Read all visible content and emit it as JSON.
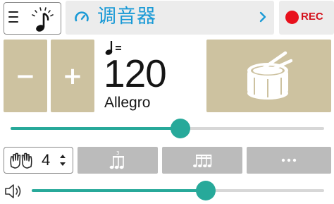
{
  "header": {
    "title": "调音器",
    "rec_label": "REC",
    "icons": {
      "menu": "hamburger-menu-icon",
      "metronome": "metronome-note-icon",
      "gauge": "tuner-gauge-icon",
      "next": "chevron-right-icon"
    }
  },
  "tempo": {
    "minus_label": "−",
    "plus_label": "+",
    "note_symbol": "quarter-note-equals",
    "bpm": "120",
    "marking": "Allegro",
    "slider_level": 0.54
  },
  "beats": {
    "count": "4",
    "icons": [
      "clap-hands-icon",
      "up-down-stepper-icon"
    ],
    "subdivision_buttons": [
      "triplet-notes-icon",
      "sixteenth-notes-icon",
      "more-options-icon"
    ]
  },
  "volume": {
    "icon": "speaker-volume-icon",
    "level": 0.59
  },
  "colors": {
    "accent_teal": "#27a99a",
    "title_blue": "#1a9ad6",
    "rec_red": "#e8101c",
    "tan": "#cdc2a0",
    "gray_button": "#bbbbbb"
  }
}
